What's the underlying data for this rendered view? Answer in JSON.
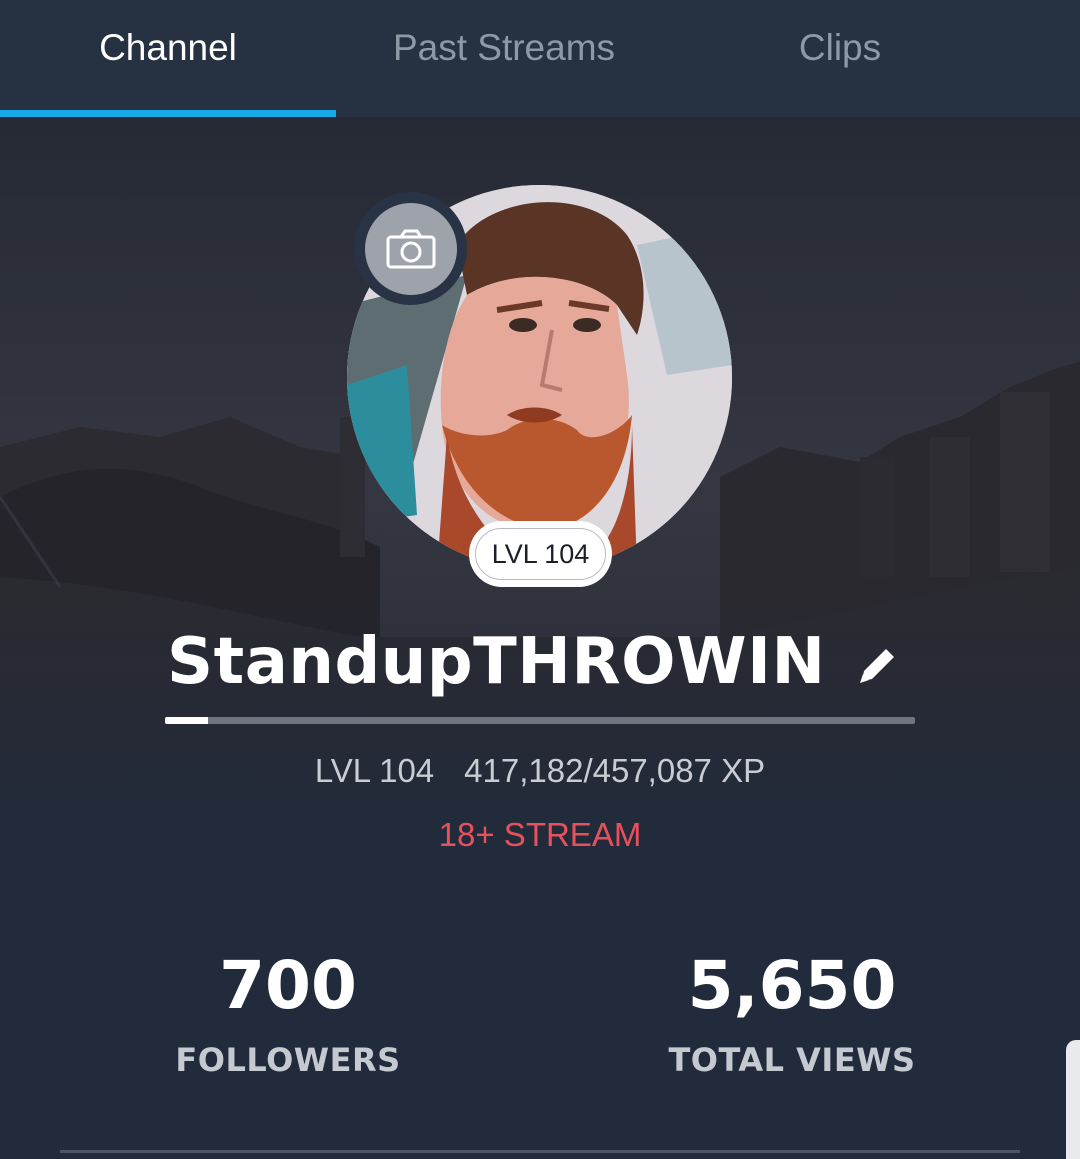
{
  "tabs": [
    {
      "label": "Channel",
      "active": true
    },
    {
      "label": "Past Streams",
      "active": false
    },
    {
      "label": "Clips",
      "active": false
    }
  ],
  "profile": {
    "avatar_badge": "LVL 104",
    "camera_icon": "camera-icon",
    "username": "StandupTHROWIN",
    "edit_icon": "pencil-icon",
    "xp_progress_fraction": 0.057,
    "level": "LVL 104",
    "xp": "417,182/457,087 XP",
    "stream_tag": "18+ STREAM"
  },
  "stats": {
    "followers_value": "700",
    "followers_label": "FOLLOWERS",
    "views_value": "5,650",
    "views_label": "TOTAL VIEWS"
  },
  "colors": {
    "tab_accent": "#1ba8e6",
    "stream_tag": "#e8505b",
    "background": "#212b3b"
  }
}
